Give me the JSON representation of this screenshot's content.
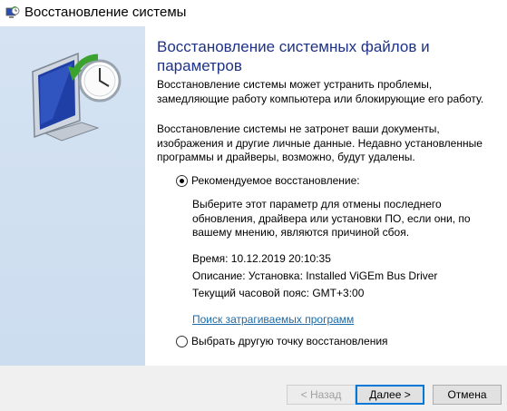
{
  "window": {
    "title": "Восстановление системы"
  },
  "content": {
    "heading": "Восстановление системных файлов и параметров",
    "paragraph1": "Восстановление системы может устранить проблемы, замедляющие работу компьютера или блокирующие его работу.",
    "paragraph2": "Восстановление системы не затронет ваши документы, изображения и другие личные данные. Недавно установленные программы и драйверы, возможно, будут удалены."
  },
  "options": {
    "recommended": {
      "label": "Рекомендуемое восстановление:",
      "checked": true,
      "description": "Выберите этот параметр для отмены последнего обновления, драйвера или установки ПО, если они, по вашему мнению, являются причиной сбоя.",
      "time": "Время: 10.12.2019 20:10:35",
      "desc": "Описание: Установка: Installed ViGEm Bus Driver",
      "timezone": "Текущий часовой пояс: GMT+3:00",
      "link": "Поиск затрагиваемых программ"
    },
    "other": {
      "label": "Выбрать другую точку восстановления",
      "checked": false
    }
  },
  "buttons": {
    "back": "< Назад",
    "next": "Далее >",
    "cancel": "Отмена"
  },
  "icons": {
    "title": "system-restore-icon",
    "hero": "system-restore-monitor-clock-icon"
  },
  "colors": {
    "heading": "#1e3287",
    "link": "#1c6aa8",
    "sidebar": "#cbdcef",
    "accent": "#0078d7"
  }
}
